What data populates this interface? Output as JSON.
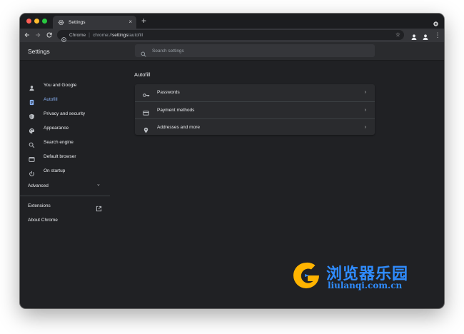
{
  "browser": {
    "tab_title": "Settings",
    "tab_close": "×",
    "new_tab": "+",
    "omnibox": {
      "chip": "Chrome",
      "separator": "|",
      "url_prefix": "chrome://",
      "url_host": "settings",
      "url_path": "/autofill"
    },
    "menu_glyph": "⋮",
    "star_glyph": "☆"
  },
  "settings": {
    "title": "Settings",
    "search_placeholder": "Search settings"
  },
  "sidebar": {
    "items": [
      {
        "label": "You and Google",
        "icon": "person-icon",
        "active": false
      },
      {
        "label": "Autofill",
        "icon": "clipboard-icon",
        "active": true
      },
      {
        "label": "Privacy and security",
        "icon": "shield-icon",
        "active": false
      },
      {
        "label": "Appearance",
        "icon": "palette-icon",
        "active": false
      },
      {
        "label": "Search engine",
        "icon": "search-icon",
        "active": false
      },
      {
        "label": "Default browser",
        "icon": "browser-icon",
        "active": false
      },
      {
        "label": "On startup",
        "icon": "power-icon",
        "active": false
      }
    ],
    "advanced_label": "Advanced",
    "advanced_chevron": "⌄",
    "extensions_label": "Extensions",
    "about_label": "About Chrome"
  },
  "main": {
    "section_title": "Autofill",
    "rows": [
      {
        "label": "Passwords",
        "icon": "key-icon",
        "chevron": "›"
      },
      {
        "label": "Payment methods",
        "icon": "credit-card-icon",
        "chevron": "›"
      },
      {
        "label": "Addresses and more",
        "icon": "location-pin-icon",
        "chevron": "›"
      }
    ]
  },
  "watermark": {
    "text_cn": "浏览器乐园",
    "url": "liulanqi.com.cn"
  },
  "colors": {
    "accent": "#8ab4f8",
    "background": "#202124",
    "card": "#2a2b2e",
    "text": "#e8eaed",
    "watermark_blue": "#2f8cff",
    "watermark_yellow": "#ffb400"
  }
}
